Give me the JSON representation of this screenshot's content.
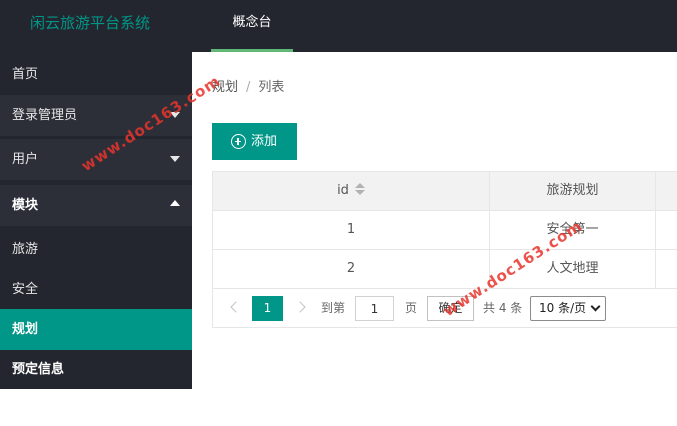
{
  "header": {
    "app_title": "闲云旅游平台系统",
    "top_tab": "概念台"
  },
  "sidebar": {
    "items": [
      {
        "label": "首页"
      },
      {
        "label": "登录管理员"
      },
      {
        "label": "用户"
      },
      {
        "label": "模块"
      },
      {
        "label": "旅游"
      },
      {
        "label": "安全"
      },
      {
        "label": "规划"
      },
      {
        "label": "预定信息"
      }
    ]
  },
  "breadcrumb": {
    "section": "规划",
    "separator": "/",
    "current": "列表"
  },
  "toolbar": {
    "add_label": "添加"
  },
  "table": {
    "columns": [
      "id",
      "旅游规划"
    ],
    "rows": [
      {
        "id": "1",
        "plan": "安全第一"
      },
      {
        "id": "2",
        "plan": "人文地理"
      }
    ]
  },
  "pagination": {
    "current_page": "1",
    "goto_prefix": "到第",
    "goto_value": "1",
    "goto_suffix": "页",
    "confirm_label": "确定",
    "total_text": "共 4 条",
    "page_size_selected": "10 条/页"
  },
  "watermark": {
    "text": "www.doc163.com"
  },
  "colors": {
    "accent": "#009688",
    "sidebar_bg": "#23262e",
    "tab_underline": "#5fb878",
    "watermark": "#e8342c"
  },
  "icons": {
    "add": "plus-circle-icon",
    "sort": "sort-icon",
    "prev": "chevron-left-icon",
    "next": "chevron-right-icon"
  }
}
